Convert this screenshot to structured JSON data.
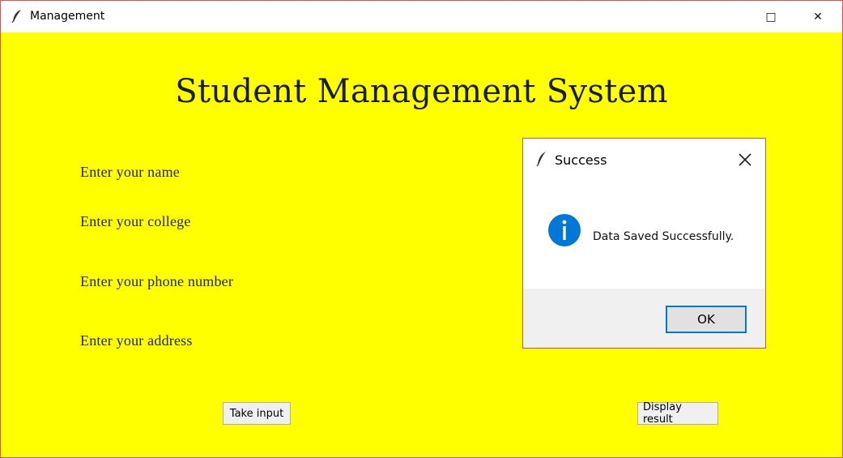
{
  "window": {
    "title": "Management",
    "controls": {
      "maximize": "□",
      "close": "✕"
    }
  },
  "main": {
    "heading": "Student Management System",
    "labels": {
      "name": "Enter your name",
      "college": "Enter your college",
      "phone": "Enter your phone number",
      "address": "Enter your address"
    },
    "buttons": {
      "take_input": "Take input",
      "display_result": "Display result"
    }
  },
  "dialog": {
    "title": "Success",
    "message": "Data Saved Successfully.",
    "ok_label": "OK"
  },
  "colors": {
    "background": "#ffff00",
    "info_icon": "#0078d7",
    "focus_border": "#0078d7"
  },
  "icons": {
    "app": "feather-icon",
    "info": "info-icon",
    "close": "close-icon"
  }
}
